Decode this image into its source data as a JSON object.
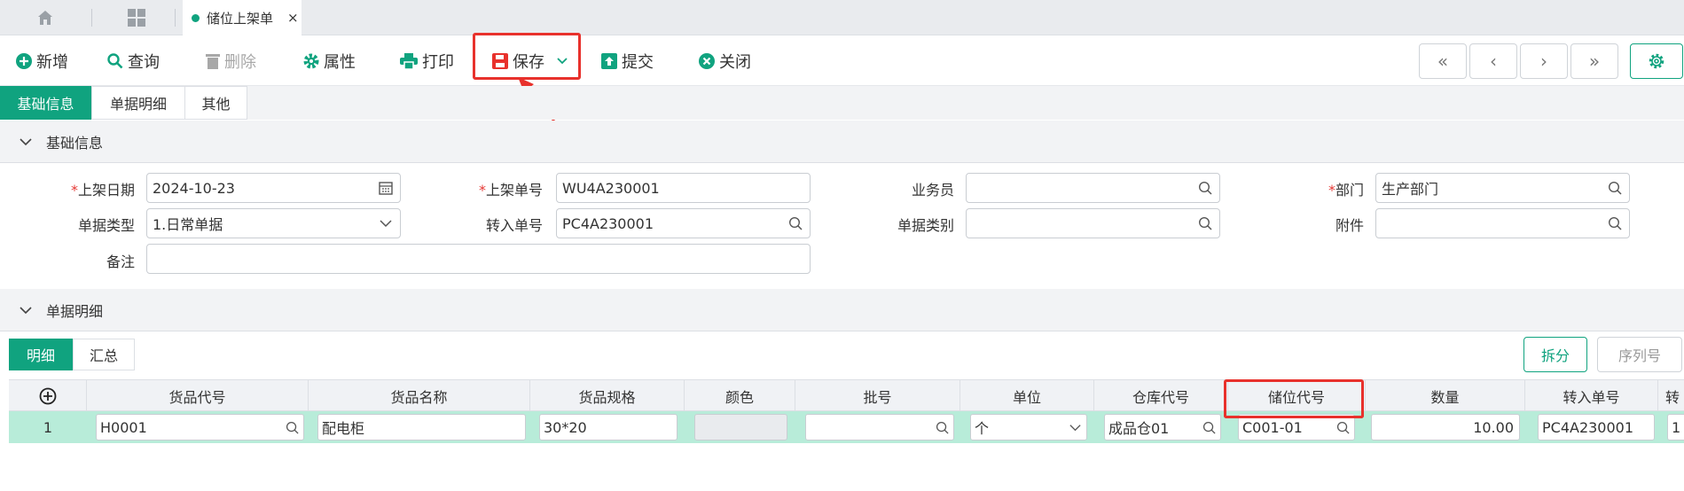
{
  "tabbar": {
    "doc_tab_label": "储位上架单",
    "close_glyph": "×"
  },
  "toolbar": {
    "new": "新增",
    "query": "查询",
    "delete": "删除",
    "props": "属性",
    "print": "打印",
    "save": "保存",
    "submit": "提交",
    "close": "关闭",
    "nav_first": "«",
    "nav_prev": "‹",
    "nav_next": "›",
    "nav_last": "»"
  },
  "page_tabs": [
    "基础信息",
    "单据明细",
    "其他"
  ],
  "section_basic": {
    "title": "基础信息"
  },
  "form": {
    "date_label": "上架日期",
    "date_value": "2024-10-23",
    "no_label": "上架单号",
    "no_value": "WU4A230001",
    "clerk_label": "业务员",
    "clerk_value": "",
    "dept_label": "部门",
    "dept_value": "生产部门",
    "doctype_label": "单据类型",
    "doctype_value": "1.日常单据",
    "transfer_label": "转入单号",
    "transfer_value": "PC4A230001",
    "category_label": "单据类别",
    "category_value": "",
    "attach_label": "附件",
    "attach_value": "",
    "remark_label": "备注",
    "remark_value": "",
    "required_mark": "*"
  },
  "section_detail": {
    "title": "单据明细"
  },
  "detail_tabs": [
    "明细",
    "汇总"
  ],
  "detail_buttons": {
    "split": "拆分",
    "serial": "序列号"
  },
  "grid": {
    "columns": [
      "货品代号",
      "货品名称",
      "货品规格",
      "颜色",
      "批号",
      "单位",
      "仓库代号",
      "储位代号",
      "数量",
      "转入单号",
      "转"
    ],
    "row": {
      "index": "1",
      "code": "H0001",
      "name": "配电柜",
      "spec": "30*20",
      "color": "",
      "batch": "",
      "unit": "个",
      "warehouse": "成品仓01",
      "location": "C001-01",
      "qty": "10.00",
      "transfer": "PC4A230001",
      "extra": "1"
    }
  },
  "colors": {
    "accent": "#10a37f",
    "highlight": "#e8312c",
    "row_selected": "#b8ecd9"
  }
}
